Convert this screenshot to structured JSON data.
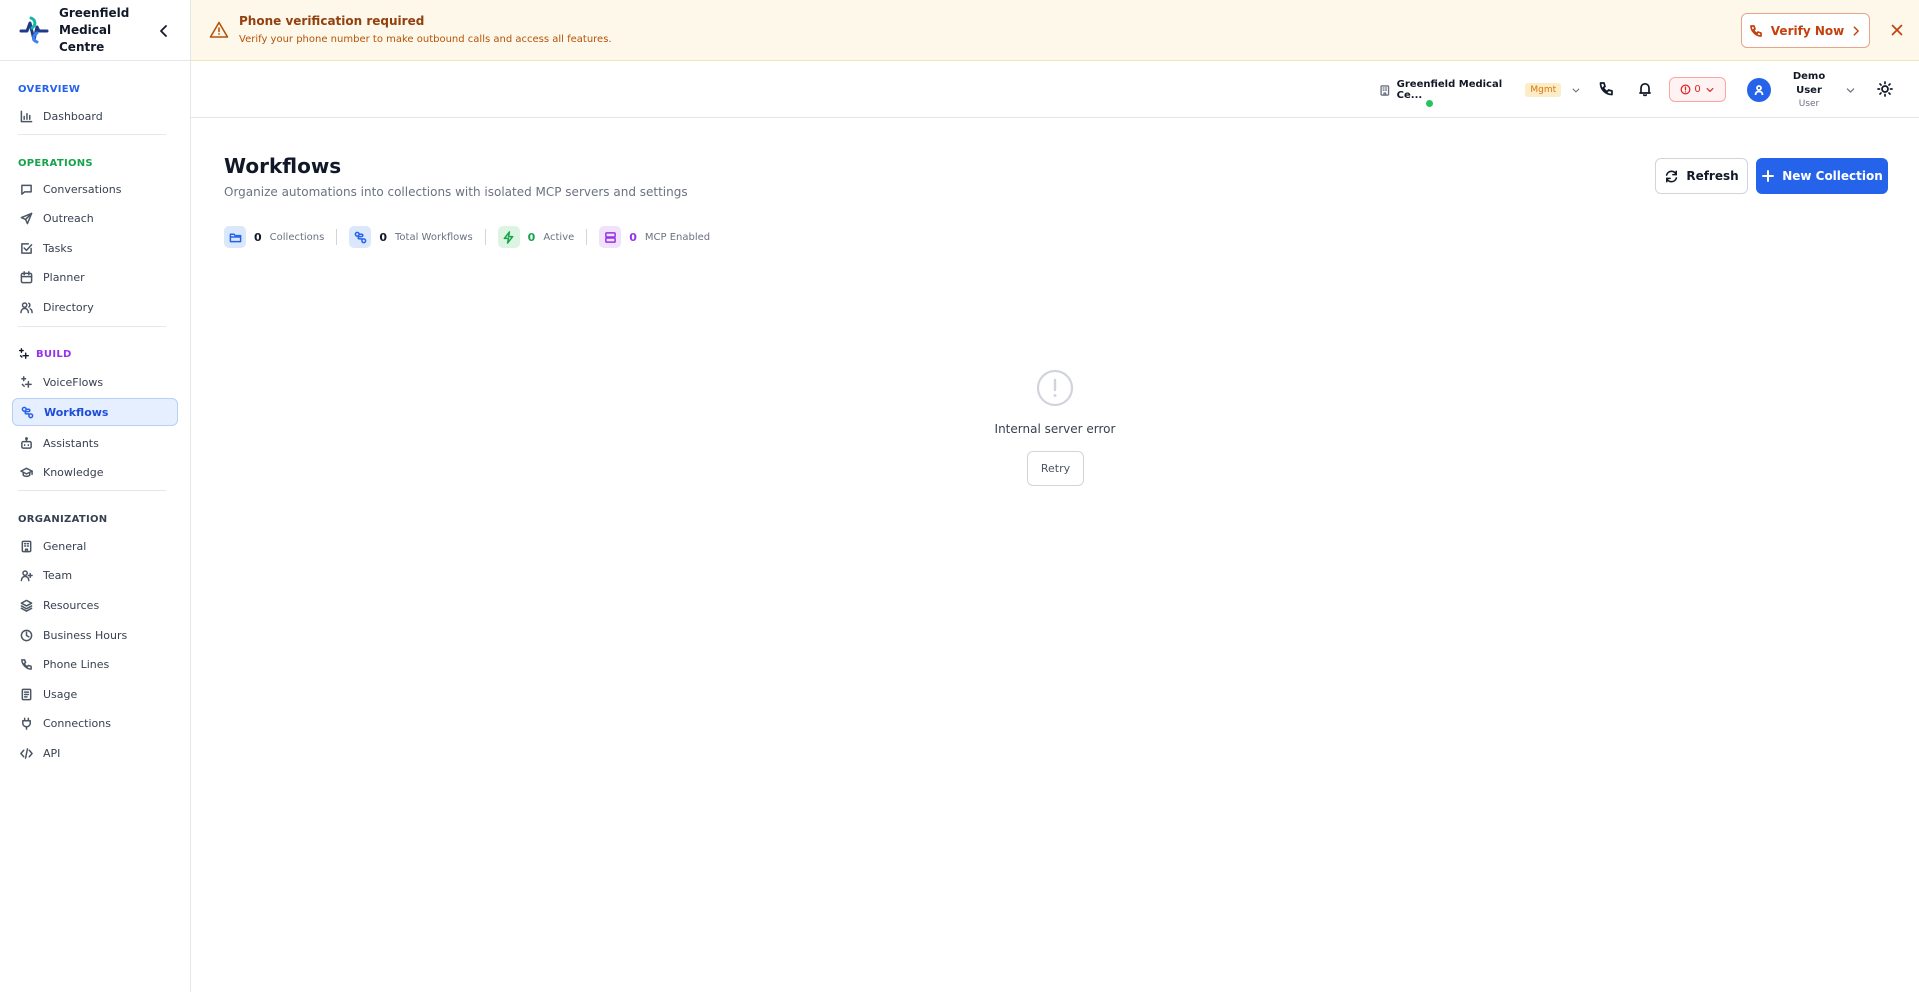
{
  "brand": {
    "name": "Greenfield Medical Centre"
  },
  "sidebar": {
    "sections": [
      {
        "title": "OVERVIEW",
        "color": "#2563eb",
        "items": [
          {
            "label": "Dashboard",
            "icon": "bar-chart-icon"
          }
        ]
      },
      {
        "title": "OPERATIONS",
        "color": "#16a34a",
        "items": [
          {
            "label": "Conversations",
            "icon": "message-icon"
          },
          {
            "label": "Outreach",
            "icon": "send-icon"
          },
          {
            "label": "Tasks",
            "icon": "checkbox-icon"
          },
          {
            "label": "Planner",
            "icon": "calendar-icon"
          },
          {
            "label": "Directory",
            "icon": "users-icon"
          }
        ]
      },
      {
        "title": "BUILD",
        "color": "#9333ea",
        "items": [
          {
            "label": "VoiceFlows",
            "icon": "sparkle-icon"
          },
          {
            "label": "Workflows",
            "icon": "workflow-icon",
            "active": true
          },
          {
            "label": "Assistants",
            "icon": "bot-icon"
          },
          {
            "label": "Knowledge",
            "icon": "graduation-cap-icon"
          }
        ]
      },
      {
        "title": "ORGANIZATION",
        "color": "#374151",
        "items": [
          {
            "label": "General",
            "icon": "building-icon"
          },
          {
            "label": "Team",
            "icon": "user-plus-icon"
          },
          {
            "label": "Resources",
            "icon": "layers-icon"
          },
          {
            "label": "Business Hours",
            "icon": "clock-icon"
          },
          {
            "label": "Phone Lines",
            "icon": "phone-icon"
          },
          {
            "label": "Usage",
            "icon": "receipt-icon"
          },
          {
            "label": "Connections",
            "icon": "plug-icon"
          },
          {
            "label": "API",
            "icon": "code-icon"
          }
        ]
      }
    ]
  },
  "banner": {
    "title": "Phone verification required",
    "subtitle": "Verify your phone number to make outbound calls and access all features.",
    "verify_label": "Verify Now"
  },
  "topbar": {
    "org_name": "Greenfield Medical Ce...",
    "org_badge": "Mgmt",
    "alert_count": "0",
    "user_name": "Demo User",
    "user_role": "User"
  },
  "main": {
    "title": "Workflows",
    "subtitle": "Organize automations into collections with isolated MCP servers and settings",
    "refresh_label": "Refresh",
    "new_label": "New Collection",
    "stats": [
      {
        "value": "0",
        "label": "Collections",
        "color": "#2563eb",
        "bg": "#dbe7fb"
      },
      {
        "value": "0",
        "label": "Total Workflows",
        "color": "#2563eb",
        "bg": "#dbe7fb"
      },
      {
        "value": "0",
        "label": "Active",
        "color": "#16a34a",
        "bg": "#dcf5e3"
      },
      {
        "value": "0",
        "label": "MCP Enabled",
        "color": "#9333ea",
        "bg": "#f0e2fb"
      }
    ],
    "error_text": "Internal server error",
    "retry_label": "Retry"
  },
  "colors": {
    "accent": "#2563eb",
    "warning": "#c2410c",
    "banner_bg": "#fef8ea"
  }
}
